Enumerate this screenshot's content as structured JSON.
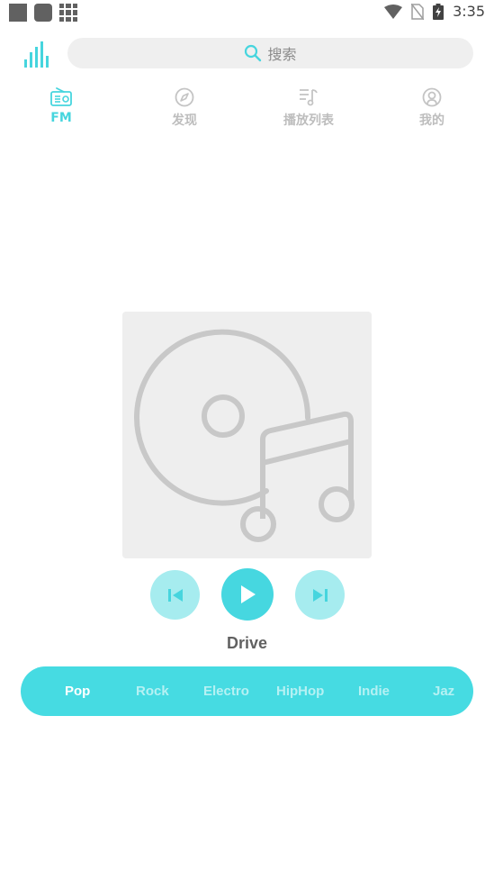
{
  "status_bar": {
    "time": "3:35"
  },
  "search": {
    "placeholder": "搜索"
  },
  "tabs": [
    {
      "label": "FM",
      "icon": "radio-icon",
      "active": true
    },
    {
      "label": "发现",
      "icon": "compass-icon",
      "active": false
    },
    {
      "label": "播放列表",
      "icon": "playlist-icon",
      "active": false
    },
    {
      "label": "我的",
      "icon": "user-icon",
      "active": false
    }
  ],
  "player": {
    "track_title": "Drive"
  },
  "genres": [
    "Pop",
    "Rock",
    "Electro",
    "HipHop",
    "Indie",
    "Jaz"
  ],
  "colors": {
    "accent": "#46d7e0",
    "accent_light": "#a6ecef",
    "inactive": "#bdbdbd"
  }
}
